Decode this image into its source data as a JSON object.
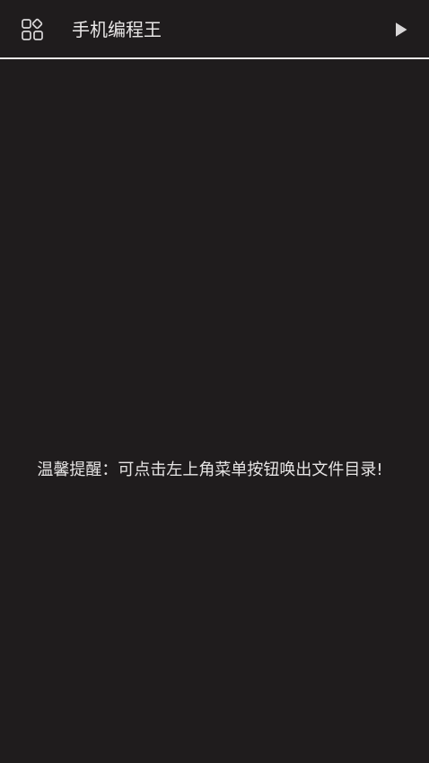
{
  "app_bar": {
    "title": "手机编程王",
    "menu_icon": "apps-grid-icon",
    "run_icon": "play-icon"
  },
  "content": {
    "tip": "温馨提醒：可点击左上角菜单按钮唤出文件目录!"
  },
  "colors": {
    "background": "#1f1c1d",
    "text": "#e6e4e4",
    "divider": "#e9e7e7",
    "icon": "#d8d6d7"
  }
}
